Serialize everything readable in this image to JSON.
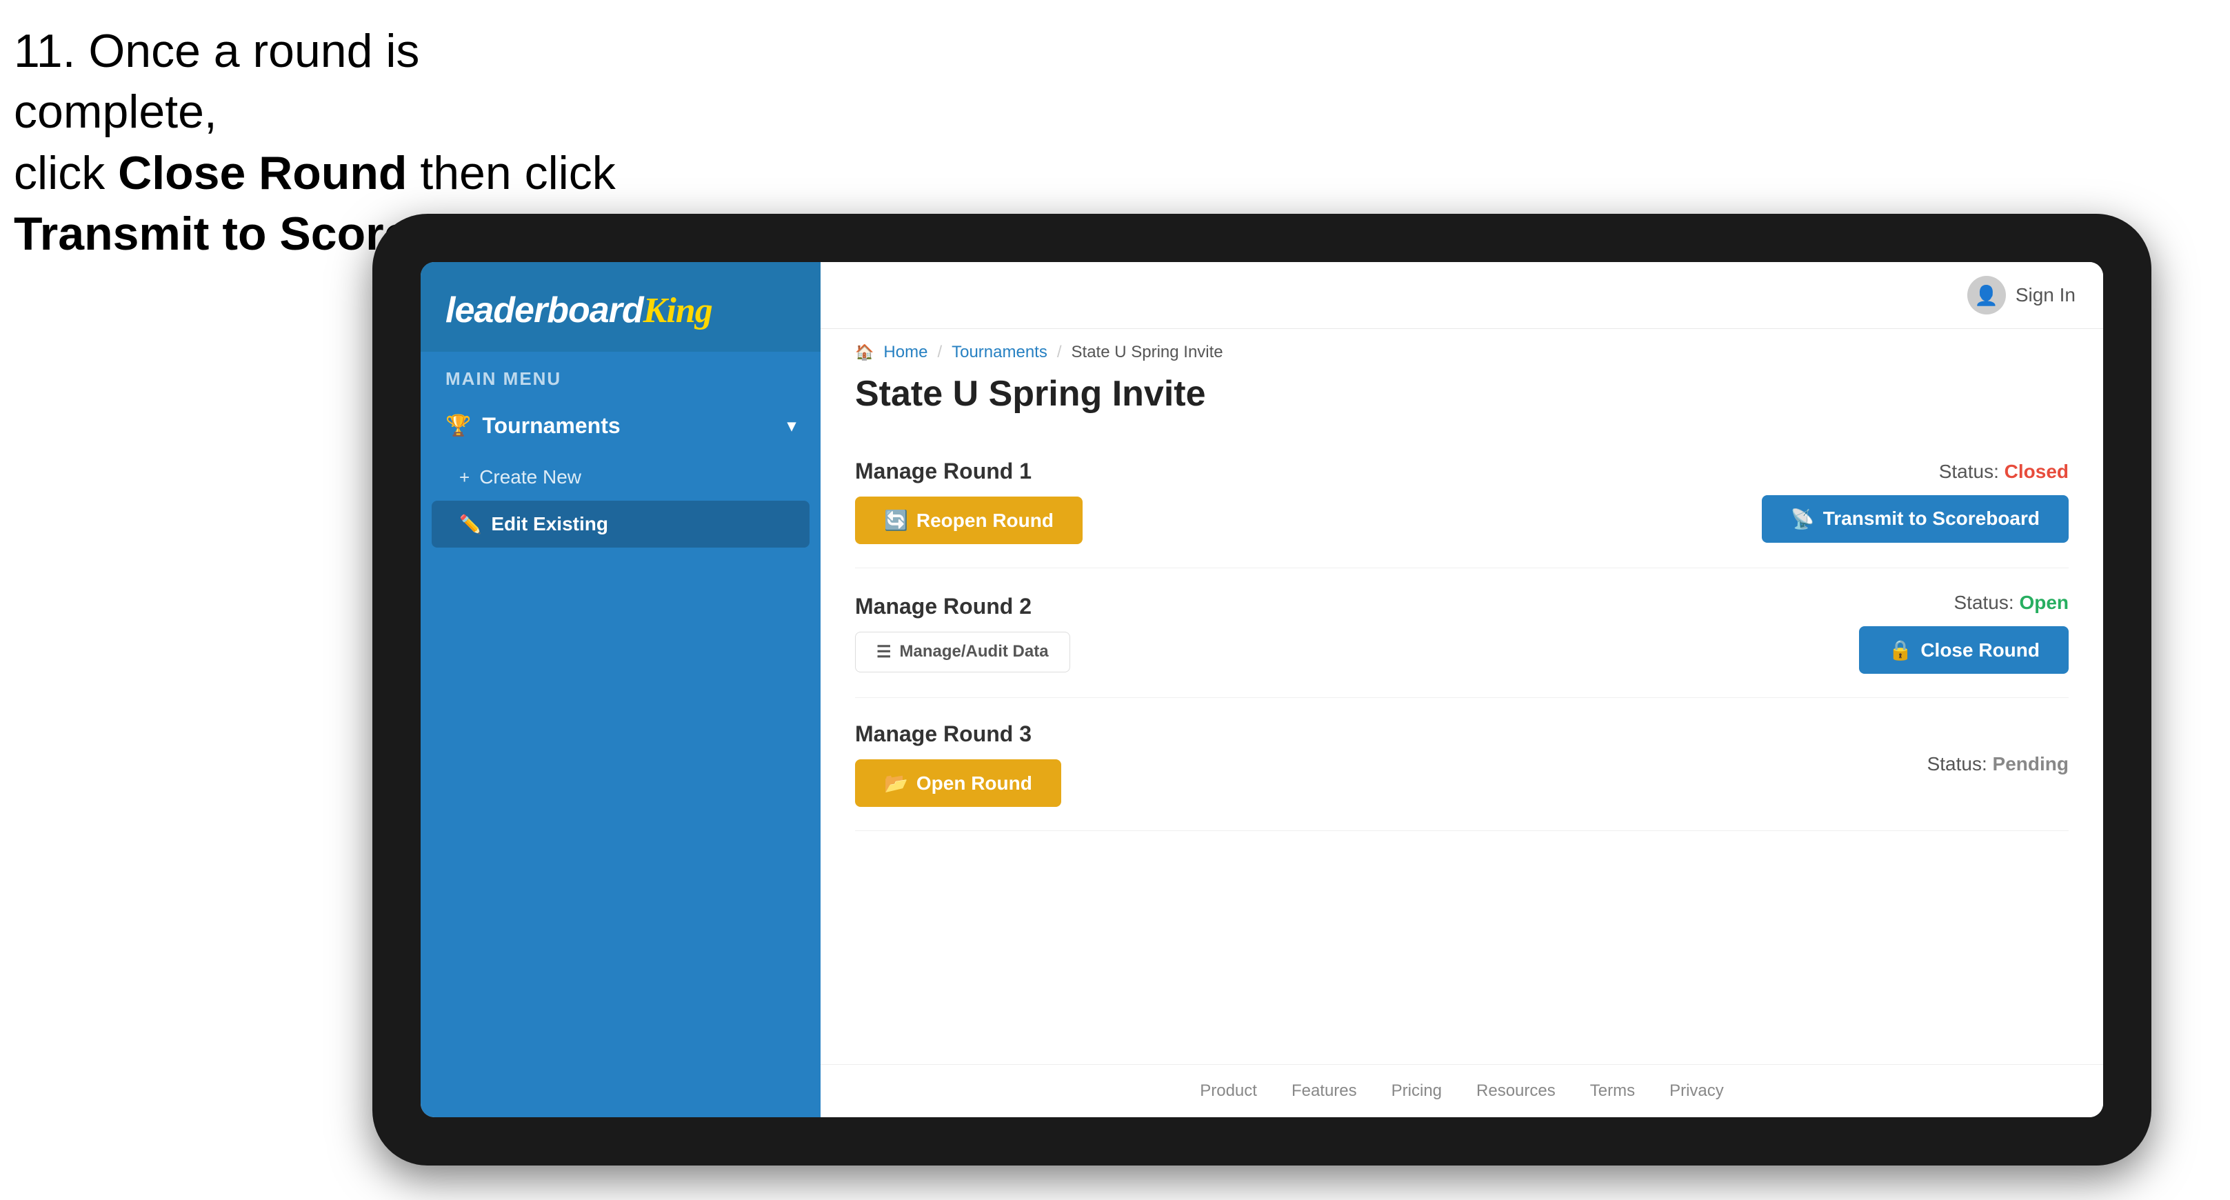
{
  "instruction": {
    "line1": "11. Once a round is complete,",
    "line2": "click ",
    "bold1": "Close Round",
    "line3": " then click",
    "bold2": "Transmit to Scoreboard."
  },
  "sidebar": {
    "logo": "leaderboard",
    "logo_highlight": "King",
    "menu_label": "MAIN MENU",
    "items": [
      {
        "label": "Tournaments",
        "icon": "🏆",
        "expanded": true
      },
      {
        "label": "Create New",
        "icon": "+"
      },
      {
        "label": "Edit Existing",
        "icon": "✏️",
        "active": true
      }
    ]
  },
  "topbar": {
    "sign_in_label": "Sign In"
  },
  "breadcrumb": {
    "home": "Home",
    "tournaments": "Tournaments",
    "current": "State U Spring Invite"
  },
  "page": {
    "title": "State U Spring Invite"
  },
  "rounds": [
    {
      "label": "Manage Round 1",
      "status_text": "Status:",
      "status_value": "Closed",
      "status_class": "status-closed",
      "btn_left_label": "Reopen Round",
      "btn_left_icon": "🔄",
      "btn_left_type": "amber",
      "btn_right_label": "Transmit to Scoreboard",
      "btn_right_icon": "📡",
      "btn_right_type": "blue"
    },
    {
      "label": "Manage Round 2",
      "status_text": "Status:",
      "status_value": "Open",
      "status_class": "status-open",
      "btn_audit_label": "Manage/Audit Data",
      "btn_audit_icon": "☰",
      "btn_right_label": "Close Round",
      "btn_right_icon": "🔒",
      "btn_right_type": "blue"
    },
    {
      "label": "Manage Round 3",
      "status_text": "Status:",
      "status_value": "Pending",
      "status_class": "status-pending",
      "btn_left_label": "Open Round",
      "btn_left_icon": "📂",
      "btn_left_type": "amber"
    }
  ],
  "footer": {
    "links": [
      "Product",
      "Features",
      "Pricing",
      "Resources",
      "Terms",
      "Privacy"
    ]
  }
}
